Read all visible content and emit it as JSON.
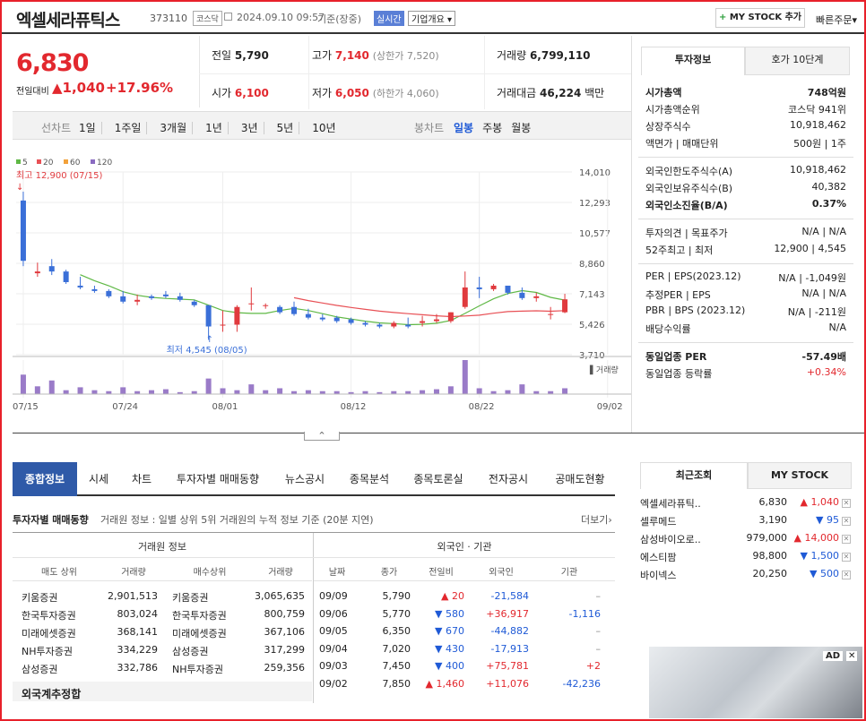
{
  "header": {
    "name": "엑셀세라퓨틱스",
    "code": "373110",
    "market": "코스닥",
    "datetime": "2024.09.10 09:57",
    "basis": "기준(장중)",
    "realtime": "실시간",
    "overview": "기업개요",
    "mystock": "MY STOCK 추가",
    "quick": "빠른주문"
  },
  "price": {
    "current": "6,830",
    "diff_label": "전일대비",
    "diff": "1,040",
    "rate": "+17.96%"
  },
  "quote": {
    "prev_label": "전일",
    "prev": "5,790",
    "high_label": "고가",
    "high": "7,140",
    "upper": "(상한가 7,520)",
    "vol_label": "거래량",
    "vol": "6,799,110",
    "open_label": "시가",
    "open": "6,100",
    "low_label": "저가",
    "low": "6,050",
    "lower": "(하한가 4,060)",
    "amt_label": "거래대금",
    "amt": "46,224",
    "amt_unit": "백만"
  },
  "periods": {
    "label": "선차트",
    "items": [
      "1일",
      "1주일",
      "3개월",
      "1년",
      "3년",
      "5년",
      "10년"
    ],
    "candle_label": "봉차트",
    "candle": [
      "일봉",
      "주봉",
      "월봉"
    ]
  },
  "legend": [
    {
      "n": "5",
      "c": "#5fb845"
    },
    {
      "n": "20",
      "c": "#e85055"
    },
    {
      "n": "60",
      "c": "#f2a13a"
    },
    {
      "n": "120",
      "c": "#8a6bc1"
    }
  ],
  "chart_data": {
    "type": "candlestick",
    "y_ticks": [
      "14,010",
      "12,293",
      "10,577",
      "8,860",
      "7,143",
      "5,426",
      "3,710"
    ],
    "ylim": [
      3710,
      14010
    ],
    "x_ticks": [
      "07/15",
      "07/24",
      "08/01",
      "08/12",
      "08/22",
      "09/02"
    ],
    "max_label": "최고 12,900 (07/15)",
    "min_label": "최저 4,545 (08/05)",
    "volume_label": "거래량",
    "candles": [
      [
        12900,
        12400,
        8700,
        9000
      ],
      [
        8900,
        8300,
        8100,
        8400
      ],
      [
        9100,
        8700,
        8200,
        8400
      ],
      [
        8500,
        8400,
        7700,
        7800
      ],
      [
        8100,
        7600,
        7400,
        7500
      ],
      [
        7600,
        7400,
        7200,
        7300
      ],
      [
        7400,
        7300,
        6900,
        7000
      ],
      [
        7300,
        7000,
        6600,
        6700
      ],
      [
        7100,
        6700,
        6500,
        6800
      ],
      [
        7100,
        7000,
        6800,
        6900
      ],
      [
        7300,
        7100,
        6900,
        7000
      ],
      [
        7200,
        7000,
        6700,
        6800
      ],
      [
        6800,
        6700,
        6400,
        6500
      ],
      [
        6500,
        6500,
        4545,
        5300
      ],
      [
        6200,
        5400,
        5000,
        5400
      ],
      [
        6500,
        5400,
        5000,
        6400
      ],
      [
        7500,
        6600,
        6200,
        6600
      ],
      [
        6600,
        6500,
        6300,
        6500
      ],
      [
        6500,
        6400,
        6000,
        6100
      ],
      [
        6700,
        6400,
        5900,
        6000
      ],
      [
        6300,
        6000,
        5700,
        5800
      ],
      [
        6000,
        5800,
        5600,
        5700
      ],
      [
        5900,
        5800,
        5500,
        5600
      ],
      [
        5800,
        5700,
        5400,
        5500
      ],
      [
        5600,
        5500,
        5300,
        5400
      ],
      [
        5500,
        5400,
        5200,
        5300
      ],
      [
        5600,
        5300,
        5200,
        5500
      ],
      [
        5800,
        5400,
        5200,
        5300
      ],
      [
        5900,
        5500,
        5300,
        5600
      ],
      [
        6000,
        5600,
        5500,
        5700
      ],
      [
        6100,
        5600,
        5500,
        6100
      ],
      [
        8400,
        6400,
        6300,
        7500
      ],
      [
        8100,
        7500,
        6900,
        7400
      ],
      [
        7700,
        7400,
        7300,
        7600
      ],
      [
        7300,
        7600,
        7100,
        7200
      ],
      [
        7500,
        7200,
        6800,
        6900
      ],
      [
        7200,
        6900,
        6700,
        7000
      ],
      [
        6400,
        6000,
        5700,
        6000
      ],
      [
        7140,
        6100,
        6050,
        6830
      ]
    ],
    "volumes": [
      20,
      8,
      14,
      4,
      7,
      4,
      3,
      7,
      3,
      4,
      5,
      2,
      3,
      16,
      6,
      4,
      10,
      4,
      6,
      3,
      4,
      3,
      3,
      2,
      3,
      2,
      3,
      3,
      4,
      5,
      8,
      35,
      6,
      3,
      4,
      10,
      3,
      3,
      6
    ]
  },
  "side": {
    "tab1": "투자정보",
    "tab2": "호가 10단계",
    "rows": [
      [
        "시가총액",
        "748억원",
        1
      ],
      [
        "시가총액순위",
        "코스닥 941위",
        0
      ],
      [
        "상장주식수",
        "10,918,462",
        0
      ],
      [
        "액면가 | 매매단위",
        "500원 | 1주",
        0
      ],
      [
        "",
        ""
      ],
      [
        "외국인한도주식수(A)",
        "10,918,462",
        0
      ],
      [
        "외국인보유주식수(B)",
        "40,382",
        0
      ],
      [
        "외국인소진율(B/A)",
        "0.37%",
        1
      ],
      [
        "",
        ""
      ],
      [
        "투자의견 | 목표주가",
        "N/A | N/A",
        0
      ],
      [
        "52주최고 | 최저",
        "12,900 | 4,545",
        0
      ],
      [
        "",
        ""
      ],
      [
        "PER | EPS(2023.12)",
        "N/A | -1,049원",
        0
      ],
      [
        "추정PER | EPS",
        "N/A | N/A",
        0
      ],
      [
        "PBR | BPS (2023.12)",
        "N/A | -211원",
        0
      ],
      [
        "배당수익률",
        "N/A",
        0
      ],
      [
        "",
        ""
      ],
      [
        "동일업종 PER",
        "-57.49배",
        1
      ],
      [
        "동일업종 등락률",
        "+0.34%",
        2
      ]
    ]
  },
  "bottom_tabs": [
    "종합정보",
    "시세",
    "차트",
    "투자자별 매매동향",
    "뉴스공시",
    "종목분석",
    "종목토론실",
    "전자공시",
    "공매도현황"
  ],
  "trade": {
    "title": "투자자별 매매동향",
    "desc": "거래원 정보 : 일별 상위 5위 거래원의 누적 정보 기준 (20분 지연)",
    "more": "더보기",
    "left_title": "거래원 정보",
    "right_title": "외국인 · 기관",
    "left_head": [
      "매도 상위",
      "거래량",
      "매수상위",
      "거래량"
    ],
    "left_rows": [
      [
        "키움증권",
        "2,901,513",
        "키움증권",
        "3,065,635"
      ],
      [
        "한국투자증권",
        "803,024",
        "한국투자증권",
        "800,759"
      ],
      [
        "미래에셋증권",
        "368,141",
        "미래에셋증권",
        "367,106"
      ],
      [
        "NH투자증권",
        "334,229",
        "삼성증권",
        "317,299"
      ],
      [
        "삼성증권",
        "332,786",
        "NH투자증권",
        "259,356"
      ]
    ],
    "foreign": "외국계추정합",
    "right_head": [
      "날짜",
      "종가",
      "전일비",
      "외국인",
      "기관"
    ],
    "right_rows": [
      [
        "09/09",
        "5,790",
        "▲ 20",
        "-21,584",
        "–"
      ],
      [
        "09/06",
        "5,770",
        "▼ 580",
        "+36,917",
        "-1,116"
      ],
      [
        "09/05",
        "6,350",
        "▼ 670",
        "-44,882",
        "–"
      ],
      [
        "09/04",
        "7,020",
        "▼ 430",
        "-17,913",
        "–"
      ],
      [
        "09/03",
        "7,450",
        "▼ 400",
        "+75,781",
        "+2"
      ],
      [
        "09/02",
        "7,850",
        "▲ 1,460",
        "+11,076",
        "-42,236"
      ]
    ]
  },
  "recent": {
    "tab1": "최근조회",
    "tab2": "MY STOCK",
    "items": [
      [
        "엑셀세라퓨틱..",
        "6,830",
        "▲ 1,040"
      ],
      [
        "셀루메드",
        "3,190",
        "▼ 95"
      ],
      [
        "삼성바이오로..",
        "979,000",
        "▲ 14,000"
      ],
      [
        "에스티팜",
        "98,800",
        "▼ 1,500"
      ],
      [
        "바이넥스",
        "20,250",
        "▼ 500"
      ]
    ],
    "ad": "AD"
  }
}
